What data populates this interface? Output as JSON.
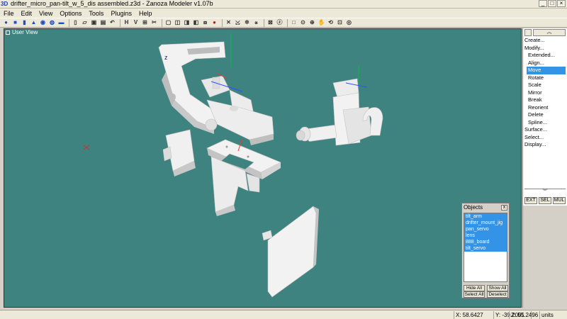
{
  "window": {
    "app_icon": "3D",
    "title": "drifter_micro_pan-tilt_w_5_dis assembled.z3d - Zanoza Modeler v1.07b",
    "controls": [
      "_",
      "□",
      "×"
    ]
  },
  "menu": [
    "File",
    "Edit",
    "View",
    "Options",
    "Tools",
    "Plugins",
    "Help"
  ],
  "toolbar": {
    "groups": [
      [
        {
          "icon": "sphere-icon",
          "glyph": "●"
        },
        {
          "icon": "box-icon",
          "glyph": "■"
        },
        {
          "icon": "cylinder-icon",
          "glyph": "▮"
        },
        {
          "icon": "cone-icon",
          "glyph": "▲"
        },
        {
          "icon": "torus-icon",
          "glyph": "◉"
        },
        {
          "icon": "tube-icon",
          "glyph": "◍"
        },
        {
          "icon": "plane-icon",
          "glyph": "▬"
        }
      ],
      [
        {
          "icon": "new-file-icon",
          "glyph": "▯"
        },
        {
          "icon": "open-file-icon",
          "glyph": "▱"
        },
        {
          "icon": "save-icon",
          "glyph": "▣"
        },
        {
          "icon": "save-as-icon",
          "glyph": "▤"
        },
        {
          "icon": "undo-icon",
          "glyph": "↶"
        }
      ],
      [
        {
          "icon": "horizontal-label",
          "glyph": "H"
        },
        {
          "icon": "vertical-label",
          "glyph": "V"
        },
        {
          "icon": "align-icon",
          "glyph": "⊞"
        },
        {
          "icon": "snap-icon",
          "glyph": "✂"
        }
      ],
      [
        {
          "icon": "view-cube-icon",
          "glyph": "▢"
        },
        {
          "icon": "view-front-icon",
          "glyph": "◫"
        },
        {
          "icon": "view-side-icon",
          "glyph": "◨"
        },
        {
          "icon": "view-top-icon",
          "glyph": "◧"
        },
        {
          "icon": "view-persp-icon",
          "glyph": "⧈"
        },
        {
          "icon": "render-icon",
          "glyph": "●"
        }
      ],
      [
        {
          "icon": "bone-icon",
          "glyph": "✕"
        },
        {
          "icon": "joint-icon",
          "glyph": "⤩"
        },
        {
          "icon": "rig-icon",
          "glyph": "✲"
        },
        {
          "icon": "skin-icon",
          "glyph": "⚹"
        }
      ],
      [
        {
          "icon": "material-icon",
          "glyph": "⊠"
        },
        {
          "icon": "texture-icon",
          "glyph": "ⓩ"
        }
      ],
      [
        {
          "icon": "select-region-icon",
          "glyph": "□"
        },
        {
          "icon": "zoom-extents-icon",
          "glyph": "⊙"
        },
        {
          "icon": "zoom-icon",
          "glyph": "⊕"
        },
        {
          "icon": "pan-icon",
          "glyph": "✋"
        },
        {
          "icon": "orbit-icon",
          "glyph": "⟲"
        },
        {
          "icon": "maximize-view-icon",
          "glyph": "⊡"
        },
        {
          "icon": "fov-icon",
          "glyph": "◎"
        }
      ]
    ]
  },
  "viewport": {
    "label": "User View",
    "background": "#3e8380",
    "axis_label": "z"
  },
  "command_panel": {
    "scroll_up": "︽",
    "scroll_down": "︾",
    "items": [
      {
        "label": "Create...",
        "level": 0,
        "selected": false
      },
      {
        "label": "Modify...",
        "level": 0,
        "selected": false
      },
      {
        "label": "Extended...",
        "level": 1,
        "selected": false
      },
      {
        "label": "Align...",
        "level": 1,
        "selected": false
      },
      {
        "label": "Move",
        "level": 1,
        "selected": true
      },
      {
        "label": "Rotate",
        "level": 1,
        "selected": false
      },
      {
        "label": "Scale",
        "level": 1,
        "selected": false
      },
      {
        "label": "Mirror",
        "level": 1,
        "selected": false
      },
      {
        "label": "Break",
        "level": 1,
        "selected": false
      },
      {
        "label": "Reorient",
        "level": 1,
        "selected": false
      },
      {
        "label": "Delete",
        "level": 1,
        "selected": false
      },
      {
        "label": "Spline...",
        "level": 1,
        "selected": false
      },
      {
        "label": "Surface...",
        "level": 0,
        "selected": false
      },
      {
        "label": "Select...",
        "level": 0,
        "selected": false
      },
      {
        "label": "Display...",
        "level": 0,
        "selected": false
      }
    ],
    "modes": [
      "EXT",
      "SEL",
      "MUL"
    ]
  },
  "objects_panel": {
    "title": "Objects",
    "close": "x",
    "objects": [
      "tilt_arm",
      "drifter_mount_jig",
      "pan_servo",
      "lens",
      "888_board",
      "tilt_servo"
    ],
    "buttons": [
      [
        "Hide All",
        "Show All"
      ],
      [
        "Select All",
        "Deselect"
      ]
    ]
  },
  "status": {
    "x": "X: 58.6427",
    "y": "Y: -39.2001",
    "z": "Z: 55.2496",
    "units": "units"
  },
  "colors": {
    "viewport_bg": "#3e8380",
    "selection": "#3393e6",
    "part_light": "#f2f2f2",
    "part_shadow": "#b9b9b9",
    "axis_x": "#3050ff",
    "axis_y": "#00c040",
    "axis_z": "#ff3030"
  }
}
